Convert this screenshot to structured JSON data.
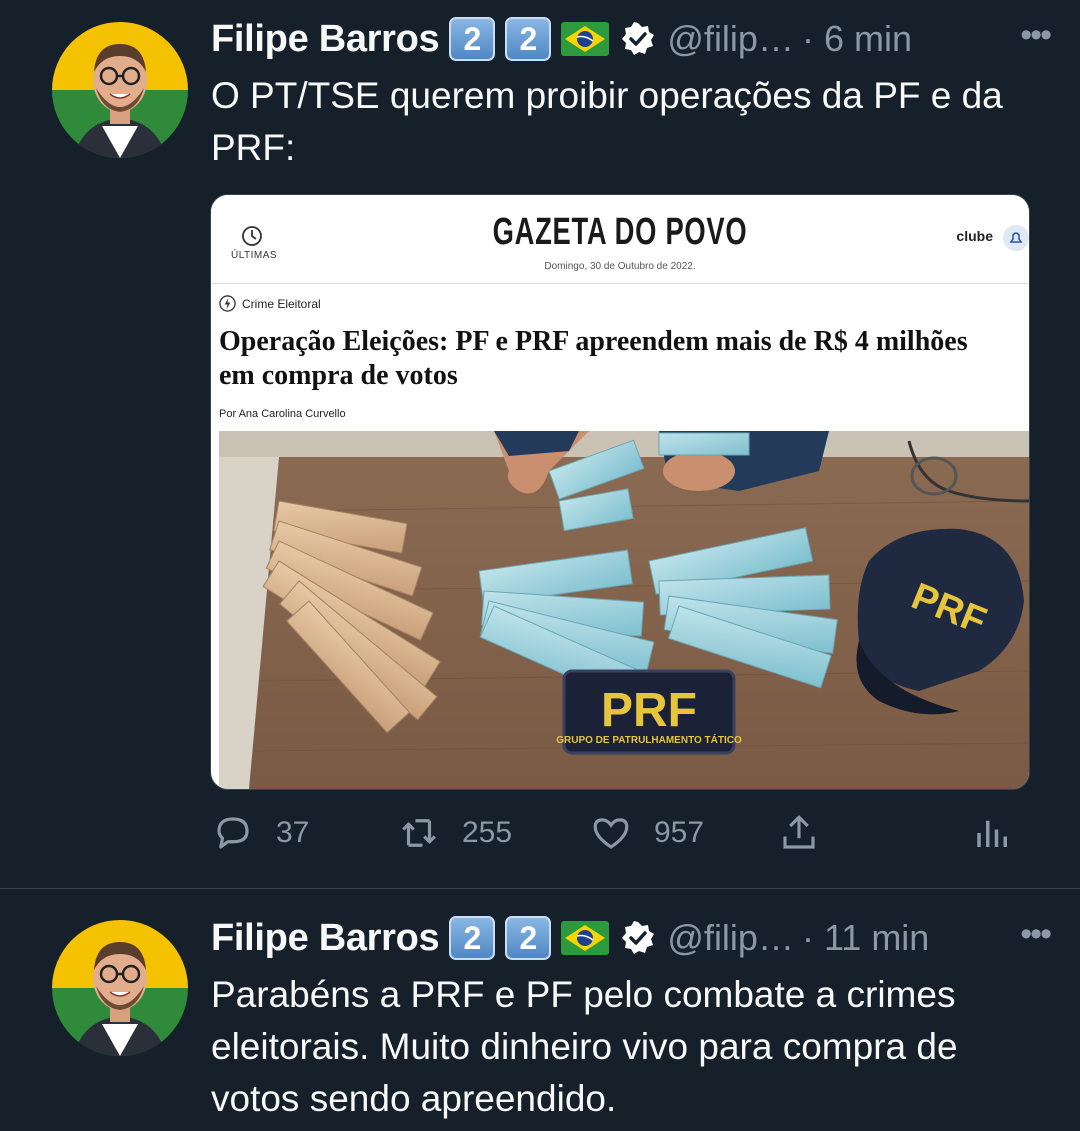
{
  "tweets": [
    {
      "author": "Filipe Barros",
      "badges": [
        "2",
        "2"
      ],
      "handle": "@filip…",
      "time": "· 6 min",
      "more": "•••",
      "text": "O PT/TSE querem proibir operações da PF e da PRF:",
      "card": {
        "ultimas_label": "ÚLTIMAS",
        "masthead": "GAZETA DO POVO",
        "date": "Domingo, 30 de Outubro de 2022.",
        "clube_label": "clube",
        "category": "Crime Eleitoral",
        "headline": "Operação Eleições: PF e PRF apreendem mais de R$ 4 milhões em compra de votos",
        "byline": "Por Ana Carolina Curvello",
        "photo": {
          "cap_text": "PRF",
          "patch_text": "PRF",
          "patch_subtext": "GRUPO DE PATRULHAMENTO TÁTICO"
        }
      },
      "stats": {
        "replies": "37",
        "retweets": "255",
        "likes": "957"
      }
    },
    {
      "author": "Filipe Barros",
      "badges": [
        "2",
        "2"
      ],
      "handle": "@filip…",
      "time": "· 11 min",
      "more": "•••",
      "text": "Parabéns a PRF e PF pelo combate a crimes eleitorais. Muito dinheiro vivo para compra de votos sendo apreendido."
    }
  ],
  "colors": {
    "background": "#15202b",
    "text_primary": "#f7f9f9",
    "text_secondary": "#8b98a5",
    "divider": "#38444d"
  },
  "icons": [
    "reply-icon",
    "retweet-icon",
    "like-icon",
    "share-icon",
    "analytics-icon",
    "verified-icon",
    "brazil-flag-icon",
    "clock-icon",
    "lightning-icon",
    "bell-icon"
  ]
}
